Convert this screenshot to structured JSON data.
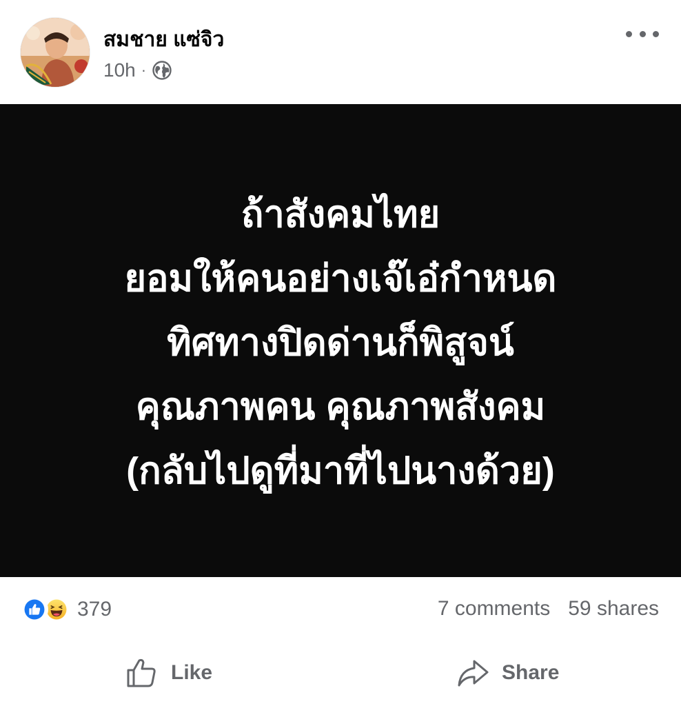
{
  "post": {
    "author": "สมชาย แซ่จิว",
    "time": "10h",
    "separator": "·",
    "privacy_icon": "globe-icon",
    "media_lines": [
      "ถ้าสังคมไทย",
      "ยอมให้คนอย่างเจ๊เอ๋กำหนด",
      "ทิศทางปิดด่านก็พิสูจน์",
      "คุณภาพคน คุณภาพสังคม",
      "(กลับไปดูที่มาที่ไปนางด้วย)"
    ],
    "media_background": "#0b0b0b",
    "media_text_color": "#ffffff"
  },
  "stats": {
    "reaction_icons": [
      "like-reaction-icon",
      "haha-reaction-icon"
    ],
    "reaction_count": "379",
    "comments": "7 comments",
    "shares": "59 shares"
  },
  "actions": {
    "like_label": "Like",
    "share_label": "Share"
  },
  "colors": {
    "like_blue": "#1877f2",
    "haha_yellow": "#f7b125",
    "secondary_text": "#65676b"
  }
}
